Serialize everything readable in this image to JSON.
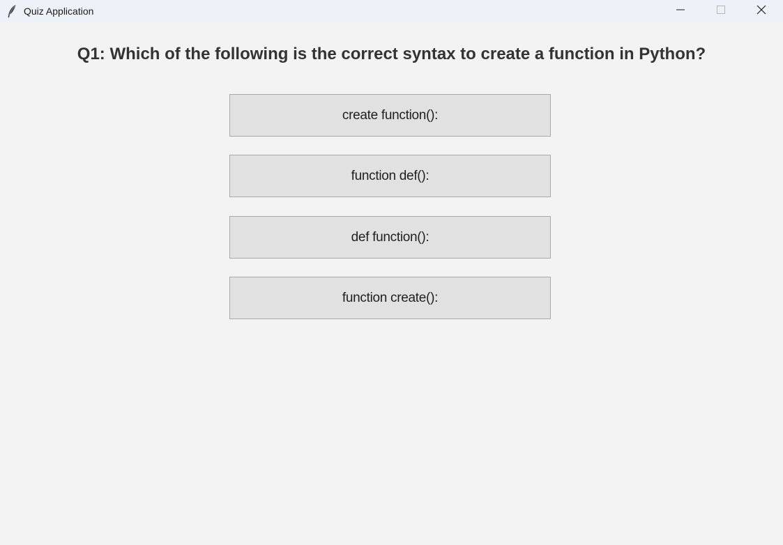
{
  "window": {
    "title": "Quiz Application",
    "app_icon": "feather-icon",
    "controls": {
      "minimize_icon": "minimize-icon",
      "maximize_icon": "maximize-icon",
      "close_icon": "close-icon"
    }
  },
  "quiz": {
    "question": "Q1: Which of the following is the correct syntax to create a function in Python?",
    "options": [
      "create function():",
      "function def():",
      "def function():",
      "function create():"
    ]
  }
}
